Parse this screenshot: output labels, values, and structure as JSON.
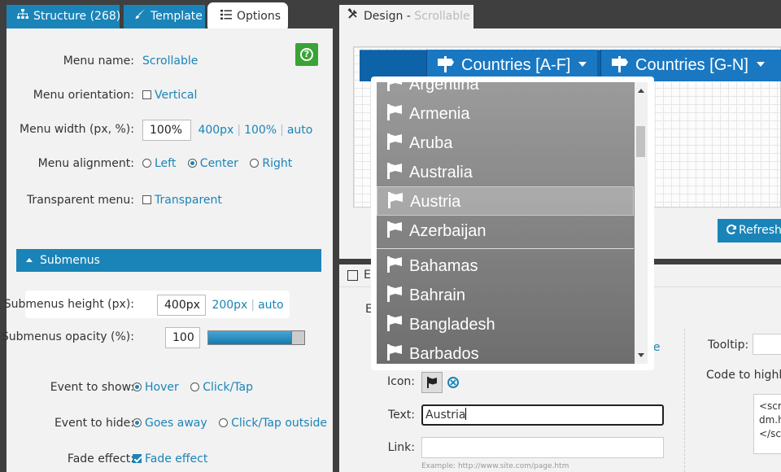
{
  "tabs": [
    {
      "label": "Structure (268)",
      "icon": "sitemap-icon"
    },
    {
      "label": "Template",
      "icon": "brush-icon"
    },
    {
      "label": "Options",
      "icon": "list-icon"
    }
  ],
  "options": {
    "menu_name": {
      "label": "Menu name:",
      "value": "Scrollable"
    },
    "orientation": {
      "label": "Menu orientation:",
      "option": "Vertical",
      "checked": false
    },
    "width": {
      "label": "Menu width (px, %):",
      "value": "100%",
      "presets": [
        "400px",
        "100%",
        "auto"
      ]
    },
    "alignment": {
      "label": "Menu alignment:",
      "options": [
        "Left",
        "Center",
        "Right"
      ],
      "selected": "Center"
    },
    "transparent": {
      "label": "Transparent menu:",
      "option": "Transparent",
      "checked": false
    },
    "submenus_header": "Submenus",
    "sub_height": {
      "label": "Submenus height (px):",
      "value": "400px",
      "presets": [
        "200px",
        "auto"
      ]
    },
    "opacity": {
      "label": "Submenus opacity (%):",
      "value": "100",
      "level": 1.0
    },
    "event_show": {
      "label": "Event to show:",
      "options": [
        "Hover",
        "Click/Tap"
      ],
      "selected": "Hover"
    },
    "event_hide": {
      "label": "Event to hide:",
      "options": [
        "Goes away",
        "Click/Tap outside"
      ],
      "selected": "Goes away"
    },
    "fade": {
      "label": "Fade effect:",
      "option": "Fade effect",
      "checked": true
    }
  },
  "design": {
    "tab_label": "Design - ",
    "tab_muted": "Scrollable",
    "menu_items": [
      "Countries [A-F]",
      "Countries [G-N]"
    ],
    "refresh_label": "Refresh"
  },
  "dropdown": {
    "items": [
      "Argentina",
      "Armenia",
      "Aruba",
      "Australia",
      "Austria",
      "Azerbaijan",
      "Bahamas",
      "Bahrain",
      "Bangladesh",
      "Barbados"
    ],
    "selected": "Austria"
  },
  "edit": {
    "header": "El",
    "ed": "Ed",
    "le": "le",
    "icon_label": "Icon:",
    "text_label": "Text:",
    "text_value": "Austria",
    "link_label": "Link:",
    "link_hint": "Example: http://www.site.com/page.htm",
    "tooltip_label": "Tooltip:",
    "code_label": "Code to highlig",
    "code_lines": [
      "<scr",
      "dm.h",
      "</sc"
    ]
  },
  "colors": {
    "accent": "#1a84b8",
    "menu_bg": "#1a78c2",
    "help": "#38a336"
  }
}
